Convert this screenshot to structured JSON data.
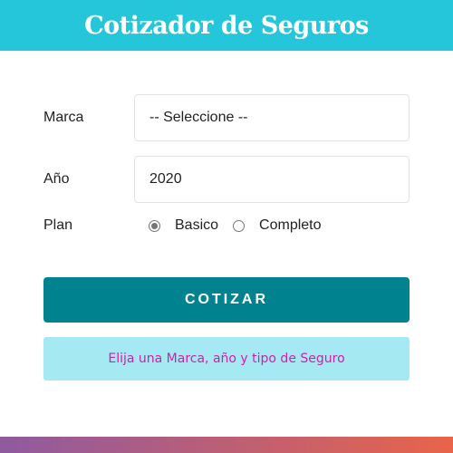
{
  "header": {
    "title": "Cotizador de Seguros"
  },
  "form": {
    "marca": {
      "label": "Marca",
      "value": "-- Seleccione --"
    },
    "anio": {
      "label": "Año",
      "value": "2020"
    },
    "plan": {
      "label": "Plan",
      "options": [
        {
          "label": "Basico",
          "checked": true
        },
        {
          "label": "Completo",
          "checked": false
        }
      ]
    },
    "submit_label": "COTIZAR"
  },
  "message": {
    "text": "Elija una Marca, año y tipo de Seguro"
  },
  "colors": {
    "header": "#26c6da",
    "button": "#00838f",
    "message_bg": "#a5eaf3",
    "message_text": "#d21fa8"
  }
}
